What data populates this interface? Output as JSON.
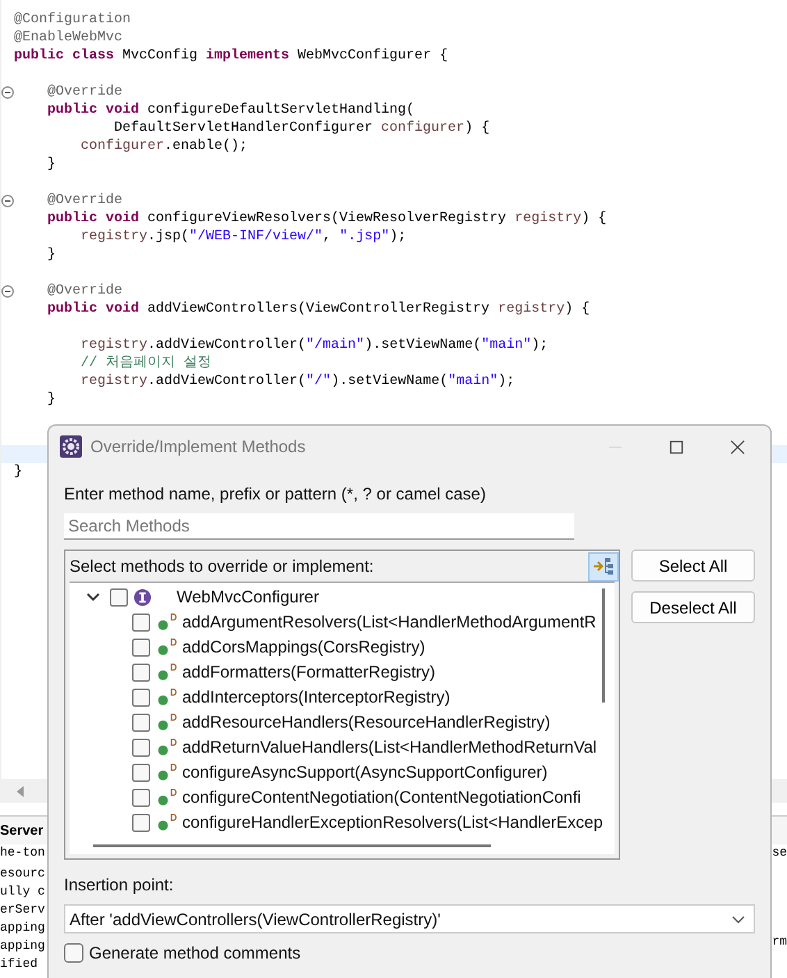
{
  "editor": {
    "lines": [
      {
        "kind": "code",
        "segments": [
          {
            "kind": "ann",
            "text": "@Configuration"
          }
        ]
      },
      {
        "kind": "code",
        "segments": [
          {
            "kind": "ann",
            "text": "@EnableWebMvc"
          }
        ]
      },
      {
        "kind": "code",
        "segments": [
          {
            "kind": "kw",
            "text": "public class"
          },
          {
            "kind": "plain",
            "text": " MvcConfig "
          },
          {
            "kind": "kw",
            "text": "implements"
          },
          {
            "kind": "plain",
            "text": " WebMvcConfigurer {"
          }
        ]
      },
      {
        "kind": "blank"
      },
      {
        "kind": "code",
        "fold": true,
        "segments": [
          {
            "kind": "ann",
            "text": "    @Override"
          }
        ]
      },
      {
        "kind": "code",
        "segments": [
          {
            "kind": "kw",
            "text": "    public void"
          },
          {
            "kind": "plain",
            "text": " configureDefaultServletHandling("
          }
        ]
      },
      {
        "kind": "code",
        "segments": [
          {
            "kind": "plain",
            "text": "            DefaultServletHandlerConfigurer "
          },
          {
            "kind": "param",
            "text": "configurer"
          },
          {
            "kind": "plain",
            "text": ") {"
          }
        ]
      },
      {
        "kind": "code",
        "segments": [
          {
            "kind": "param",
            "text": "        configurer"
          },
          {
            "kind": "plain",
            "text": ".enable();"
          }
        ]
      },
      {
        "kind": "code",
        "segments": [
          {
            "kind": "plain",
            "text": "    }"
          }
        ]
      },
      {
        "kind": "blank"
      },
      {
        "kind": "code",
        "fold": true,
        "segments": [
          {
            "kind": "ann",
            "text": "    @Override"
          }
        ]
      },
      {
        "kind": "code",
        "segments": [
          {
            "kind": "kw",
            "text": "    public void"
          },
          {
            "kind": "plain",
            "text": " configureViewResolvers(ViewResolverRegistry "
          },
          {
            "kind": "param",
            "text": "registry"
          },
          {
            "kind": "plain",
            "text": ") {"
          }
        ]
      },
      {
        "kind": "code",
        "segments": [
          {
            "kind": "param",
            "text": "        registry"
          },
          {
            "kind": "plain",
            "text": ".jsp("
          },
          {
            "kind": "str",
            "text": "\"/WEB-INF/view/\""
          },
          {
            "kind": "plain",
            "text": ", "
          },
          {
            "kind": "str",
            "text": "\".jsp\""
          },
          {
            "kind": "plain",
            "text": ");"
          }
        ]
      },
      {
        "kind": "code",
        "segments": [
          {
            "kind": "plain",
            "text": "    }"
          }
        ]
      },
      {
        "kind": "blank"
      },
      {
        "kind": "code",
        "fold": true,
        "segments": [
          {
            "kind": "ann",
            "text": "    @Override"
          }
        ]
      },
      {
        "kind": "code",
        "segments": [
          {
            "kind": "kw",
            "text": "    public void"
          },
          {
            "kind": "plain",
            "text": " addViewControllers(ViewControllerRegistry "
          },
          {
            "kind": "param",
            "text": "registry"
          },
          {
            "kind": "plain",
            "text": ") {"
          }
        ]
      },
      {
        "kind": "blank"
      },
      {
        "kind": "code",
        "segments": [
          {
            "kind": "param",
            "text": "        registry"
          },
          {
            "kind": "plain",
            "text": ".addViewController("
          },
          {
            "kind": "str",
            "text": "\"/main\""
          },
          {
            "kind": "plain",
            "text": ").setViewName("
          },
          {
            "kind": "str",
            "text": "\"main\""
          },
          {
            "kind": "plain",
            "text": ");"
          }
        ]
      },
      {
        "kind": "code",
        "segments": [
          {
            "kind": "comment",
            "text": "        // 처음페이지 설정"
          }
        ]
      },
      {
        "kind": "code",
        "segments": [
          {
            "kind": "param",
            "text": "        registry"
          },
          {
            "kind": "plain",
            "text": ".addViewController("
          },
          {
            "kind": "str",
            "text": "\"/\""
          },
          {
            "kind": "plain",
            "text": ").setViewName("
          },
          {
            "kind": "str",
            "text": "\"main\""
          },
          {
            "kind": "plain",
            "text": ");"
          }
        ]
      },
      {
        "kind": "code",
        "segments": [
          {
            "kind": "plain",
            "text": "    }"
          }
        ]
      },
      {
        "kind": "blank"
      },
      {
        "kind": "blank"
      },
      {
        "kind": "current"
      },
      {
        "kind": "code",
        "segments": [
          {
            "kind": "plain",
            "text": "}"
          }
        ]
      }
    ]
  },
  "console": {
    "tab": "Server",
    "left_lines": [
      "he-ton",
      "esourc",
      "ully c",
      "erServ",
      "apping",
      "apping",
      "ified"
    ],
    "right_lines": [
      "se",
      "rm"
    ]
  },
  "dialog": {
    "title": "Override/Implement Methods",
    "prompt": "Enter method name, prefix or pattern (*, ? or camel case)",
    "search": {
      "placeholder": "Search Methods"
    },
    "list_label": "Select methods to override or implement:",
    "buttons": [
      "Select All",
      "Deselect All"
    ],
    "tree": [
      {
        "label": "WebMvcConfigurer",
        "checked": false,
        "expanded": true,
        "children": [
          {
            "label": "addArgumentResolvers(List<HandlerMethodArgumentR",
            "checked": false
          },
          {
            "label": "addCorsMappings(CorsRegistry)",
            "checked": false
          },
          {
            "label": "addFormatters(FormatterRegistry)",
            "checked": false
          },
          {
            "label": "addInterceptors(InterceptorRegistry)",
            "checked": false
          },
          {
            "label": "addResourceHandlers(ResourceHandlerRegistry)",
            "checked": false
          },
          {
            "label": "addReturnValueHandlers(List<HandlerMethodReturnVal",
            "checked": false
          },
          {
            "label": "configureAsyncSupport(AsyncSupportConfigurer)",
            "checked": false
          },
          {
            "label": "configureContentNegotiation(ContentNegotiationConfi",
            "checked": false
          },
          {
            "label": "configureHandlerExceptionResolvers(List<HandlerExcep",
            "checked": false
          }
        ]
      }
    ],
    "insertion_label": "Insertion point:",
    "insertion_value": "After 'addViewControllers(ViewControllerRegistry)'",
    "generate_comments": {
      "label": "Generate method comments",
      "checked": false
    }
  }
}
